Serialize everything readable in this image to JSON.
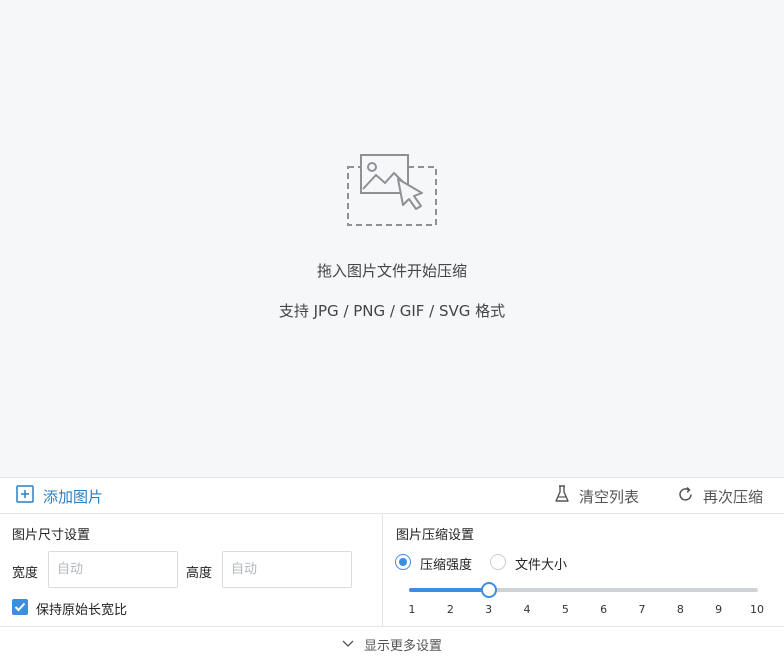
{
  "dropzone": {
    "icon": "image-upload-icon",
    "main_text": "拖入图片文件开始压缩",
    "sub_text": "支持 JPG / PNG / GIF / SVG 格式"
  },
  "toolbar": {
    "add_label": "添加图片",
    "add_icon": "plus-square-icon",
    "clear_label": "清空列表",
    "clear_icon": "flask-icon",
    "redo_label": "再次压缩",
    "redo_icon": "refresh-icon",
    "accent_color": "#2d7fc1"
  },
  "size_settings": {
    "title": "图片尺寸设置",
    "width_label": "宽度",
    "width_value": "",
    "width_placeholder": "自动",
    "height_label": "高度",
    "height_value": "",
    "height_placeholder": "自动",
    "keep_ratio_label": "保持原始长宽比",
    "keep_ratio_checked": true
  },
  "compress_settings": {
    "title": "图片压缩设置",
    "options": [
      {
        "label": "压缩强度",
        "selected": true
      },
      {
        "label": "文件大小",
        "selected": false
      }
    ],
    "slider": {
      "value": 3,
      "ticks": [
        "1",
        "2",
        "3",
        "4",
        "5",
        "6",
        "7",
        "8",
        "9",
        "10"
      ]
    },
    "accent_color": "#3b8ee0"
  },
  "footer": {
    "label": "显示更多设置",
    "icon": "chevron-down-icon"
  }
}
